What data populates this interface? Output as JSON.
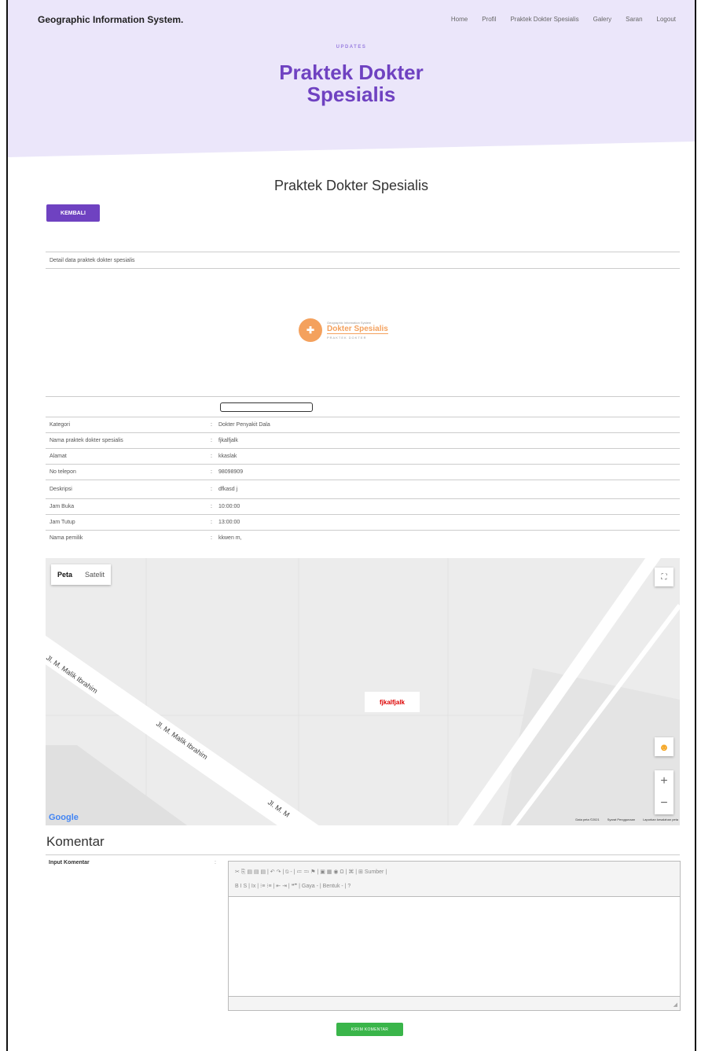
{
  "header": {
    "brand": "Geographic Information System.",
    "nav": [
      "Home",
      "Profil",
      "Praktek Dokter Spesialis",
      "Galery",
      "Saran",
      "Logout"
    ],
    "updates": "UPDATES",
    "hero_title": "Praktek Dokter Spesialis"
  },
  "main": {
    "section_title": "Praktek Dokter Spesialis",
    "back_button": "KEMBALI",
    "detail_caption": "Detail data praktek dokter spesialis",
    "logo": {
      "small": "Geographic Information System",
      "big": "Dokter Spesialis",
      "sub": "PRAKTEK DOKTER"
    },
    "details": [
      {
        "label": "Kategori",
        "sep": ":",
        "value": "Dokter Penyakit Dala"
      },
      {
        "label": "Nama praktek dokter spesialis",
        "sep": ":",
        "value": "fjkalfjalk"
      },
      {
        "label": "Alamat",
        "sep": ":",
        "value": "kkaslak"
      },
      {
        "label": "No telepon",
        "sep": ":",
        "value": "98098909"
      },
      {
        "label": "Deskripsi",
        "sep": ":",
        "value": "dfkasd j"
      },
      {
        "label": "Jam Buka",
        "sep": ":",
        "value": "10:00:00"
      },
      {
        "label": "Jam Tutup",
        "sep": ":",
        "value": "13:00:00"
      },
      {
        "label": "Nama pemilik",
        "sep": ":",
        "value": "kkwen m,"
      }
    ]
  },
  "map": {
    "tab_map": "Peta",
    "tab_satellite": "Satelit",
    "marker_label": "fjkalfjalk",
    "street_1": "Jl. M. Malik Ibrahim",
    "street_2": "Jl. M. Malik Ibrahim",
    "street_3": "Jl. M. M",
    "google": "Google",
    "footer": [
      "Data peta ©2021",
      "Syarat Penggunaan",
      "Laporkan kesalahan peta"
    ]
  },
  "komentar": {
    "title": "Komentar",
    "input_label": "Input Komentar",
    "sep": ":",
    "toolbar_row1": "✂ ⎘ ▤ ▤ ▤ | ↶ ↷ | ⍉ - | ≔ ≕ ⚑ | ▣ ▦ ◉ Ω | ⌘ | ⊞ Sumber |",
    "toolbar_row2": "B I S | Ix | ⁝≡ ⁝≡ | ⇤ ⇥ | ❝❞ | Gaya - | Bentuk - | ?",
    "submit": "KIRIM KOMENTAR"
  }
}
